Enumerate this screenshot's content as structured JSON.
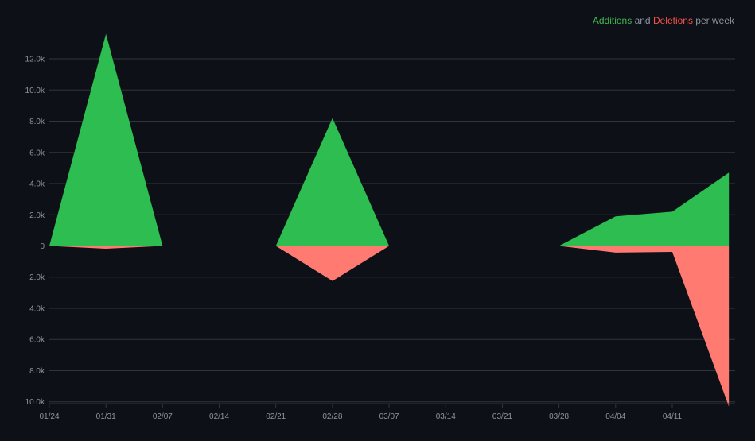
{
  "legend": {
    "additions_label": "Additions",
    "joiner": " and ",
    "deletions_label": "Deletions",
    "suffix": " per week"
  },
  "colors": {
    "background": "#0d1117",
    "additions": "#2dbd50",
    "deletions": "#ff7b72",
    "grid": "#30363d",
    "text": "#8b949e",
    "legend_additions": "#3fb950",
    "legend_deletions": "#f85149"
  },
  "chart_data": {
    "type": "area",
    "title": "Additions and Deletions per week",
    "x_ticks": [
      "01/24",
      "01/31",
      "02/07",
      "02/14",
      "02/21",
      "02/28",
      "03/07",
      "03/14",
      "03/21",
      "03/28",
      "04/04",
      "04/11"
    ],
    "y_ticks": [
      {
        "value": 12000,
        "label": "12.0k"
      },
      {
        "value": 10000,
        "label": "10.0k"
      },
      {
        "value": 8000,
        "label": "8.0k"
      },
      {
        "value": 6000,
        "label": "6.0k"
      },
      {
        "value": 4000,
        "label": "4.0k"
      },
      {
        "value": 2000,
        "label": "2.0k"
      },
      {
        "value": 0,
        "label": "0"
      },
      {
        "value": -2000,
        "label": "2.0k"
      },
      {
        "value": -4000,
        "label": "4.0k"
      },
      {
        "value": -6000,
        "label": "6.0k"
      },
      {
        "value": -8000,
        "label": "8.0k"
      },
      {
        "value": -10000,
        "label": "10.0k"
      }
    ],
    "ylim": [
      -10300,
      13600
    ],
    "grid": true,
    "legend_position": "top-right",
    "series": [
      {
        "name": "Additions",
        "segments": [
          {
            "x": [
              "01/24",
              "01/31",
              "02/07"
            ],
            "y": [
              0,
              13600,
              0
            ]
          },
          {
            "x": [
              "02/21",
              "02/28",
              "03/07"
            ],
            "y": [
              0,
              8200,
              0
            ]
          },
          {
            "x": [
              "03/28",
              "04/04",
              "04/11",
              "04/18"
            ],
            "y": [
              0,
              1900,
              2200,
              4700
            ]
          }
        ]
      },
      {
        "name": "Deletions",
        "segments": [
          {
            "x": [
              "01/24",
              "01/31",
              "02/07"
            ],
            "y": [
              0,
              -180,
              0
            ]
          },
          {
            "x": [
              "02/21",
              "02/28",
              "03/07"
            ],
            "y": [
              0,
              -2250,
              0
            ]
          },
          {
            "x": [
              "03/28",
              "04/04",
              "04/11",
              "04/18"
            ],
            "y": [
              0,
              -430,
              -380,
              -10300
            ]
          }
        ]
      }
    ]
  }
}
